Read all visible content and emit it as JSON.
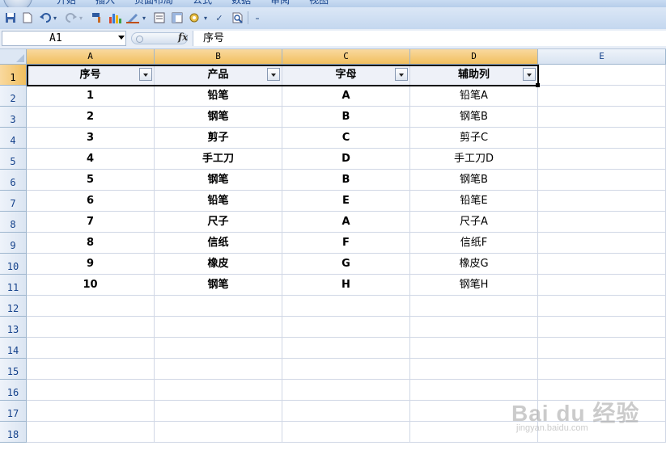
{
  "ribbon": {
    "tabs": [
      "开始",
      "插入",
      "页面布局",
      "公式",
      "数据",
      "审阅",
      "视图"
    ]
  },
  "quick_access": {
    "icons": [
      "save-icon",
      "new-icon",
      "undo-icon",
      "redo-icon",
      "format-painter-icon",
      "chart-icon",
      "draw-icon",
      "form-icon",
      "pivot-icon",
      "tools-icon",
      "spelling-icon",
      "print-preview-icon",
      "customize-icon"
    ]
  },
  "formula_bar": {
    "name_box": "A1",
    "formula": "序号"
  },
  "sheet": {
    "columns": [
      "A",
      "B",
      "C",
      "D",
      "E"
    ],
    "row_numbers": [
      "1",
      "2",
      "3",
      "4",
      "5",
      "6",
      "7",
      "8",
      "9",
      "10",
      "11",
      "12",
      "13",
      "14",
      "15",
      "16",
      "17",
      "18"
    ],
    "headers": [
      "序号",
      "产品",
      "字母",
      "辅助列"
    ],
    "rows": [
      [
        "1",
        "铅笔",
        "A",
        "铅笔A"
      ],
      [
        "2",
        "钢笔",
        "B",
        "钢笔B"
      ],
      [
        "3",
        "剪子",
        "C",
        "剪子C"
      ],
      [
        "4",
        "手工刀",
        "D",
        "手工刀D"
      ],
      [
        "5",
        "钢笔",
        "B",
        "钢笔B"
      ],
      [
        "6",
        "铅笔",
        "E",
        "铅笔E"
      ],
      [
        "7",
        "尺子",
        "A",
        "尺子A"
      ],
      [
        "8",
        "信纸",
        "F",
        "信纸F"
      ],
      [
        "9",
        "橡皮",
        "G",
        "橡皮G"
      ],
      [
        "10",
        "钢笔",
        "H",
        "钢笔H"
      ]
    ]
  },
  "watermark": {
    "main": "Bai du 经验",
    "sub": "jingyan.baidu.com"
  },
  "colors": {
    "selected_header": "#f1bf5e",
    "header_blue": "#15428b",
    "gridline": "#d0d7e5"
  }
}
